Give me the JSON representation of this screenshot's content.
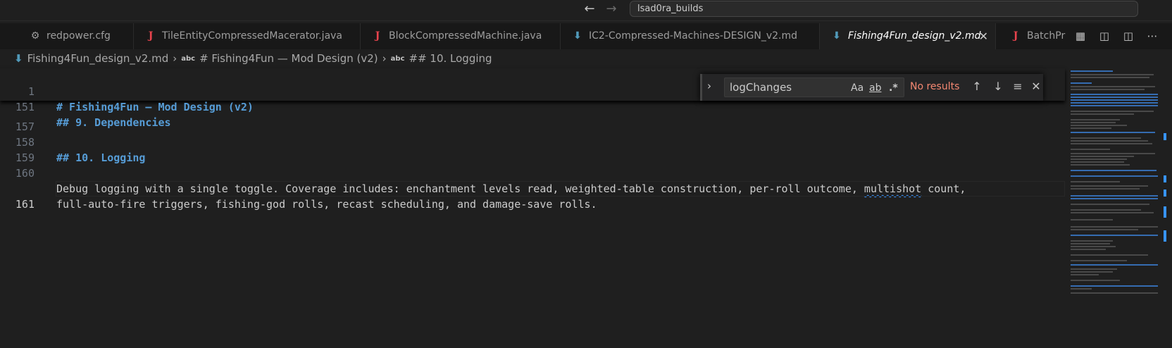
{
  "titlebar": {
    "back_icon": "arrow-left-icon",
    "forward_icon": "arrow-right-icon",
    "search_text": "lsad0ra_builds"
  },
  "tabs": [
    {
      "label": "redpower.cfg",
      "icon": "gear-icon",
      "active": false
    },
    {
      "label": "TileEntityCompressedMacerator.java",
      "icon": "java-icon",
      "active": false
    },
    {
      "label": "BlockCompressedMachine.java",
      "icon": "java-icon",
      "active": false
    },
    {
      "label": "IC2-Compressed-Machines-DESIGN_v2.md",
      "icon": "markdown-icon",
      "active": false
    },
    {
      "label": "Fishing4Fun_design_v2.md",
      "icon": "markdown-icon",
      "active": true
    },
    {
      "label": "BatchPr",
      "icon": "java-icon",
      "active": false
    }
  ],
  "tab_actions": [
    "open-changes-icon",
    "open-preview-icon",
    "split-editor-icon",
    "more-actions-icon"
  ],
  "breadcrumb": {
    "file": "Fishing4Fun_design_v2.md",
    "symbol1_prefix": "abc",
    "symbol1": "# Fishing4Fun — Mod Design (v2)",
    "symbol2_prefix": "abc",
    "symbol2": "## 10. Logging"
  },
  "editor": {
    "sticky": [
      {
        "num": "1",
        "text": "# Fishing4Fun — Mod Design (v2)"
      },
      {
        "num": "151",
        "text": "## 9. Dependencies"
      }
    ],
    "lines": [
      {
        "num": "157",
        "text": ""
      },
      {
        "num": "158",
        "text": "## 10. Logging"
      },
      {
        "num": "159",
        "text": ""
      },
      {
        "num": "160",
        "text_a": "Debug logging with a single toggle. Coverage includes: enchantment levels read, weighted-table construction, per-roll outcome, ",
        "text_squiggle": "multishot",
        "text_b": " count,"
      },
      {
        "num": "",
        "text": "full-auto-fire triggers, fishing-god rolls, recast scheduling, and damage-save rolls."
      },
      {
        "num": "161",
        "text": ""
      }
    ]
  },
  "find": {
    "query": "logChanges",
    "match_case_label": "Aa",
    "whole_word_label": "ab",
    "regex_label": ".*",
    "status": "No results"
  },
  "colors": {
    "accent": "#3794ff",
    "heading": "#569cd6",
    "no_results": "#f48771"
  }
}
